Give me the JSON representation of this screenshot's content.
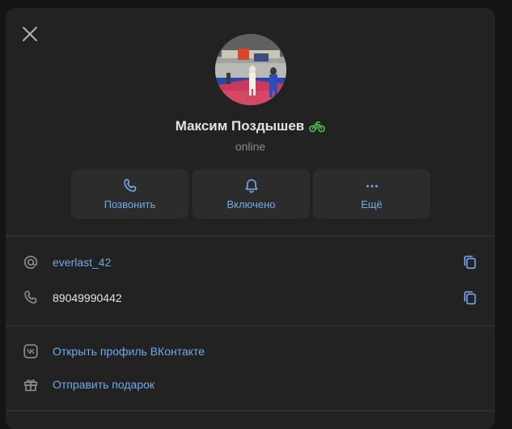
{
  "profile": {
    "name": "Максим Поздышев",
    "status": "online"
  },
  "actions": [
    {
      "label": "Позвонить",
      "icon": "phone-icon"
    },
    {
      "label": "Включено",
      "icon": "bell-icon"
    },
    {
      "label": "Ещё",
      "icon": "more-icon"
    }
  ],
  "contacts": {
    "username": "everlast_42",
    "phone": "89049990442"
  },
  "links": {
    "vk_profile": "Открыть профиль ВКонтакте",
    "send_gift": "Отправить подарок"
  },
  "colors": {
    "background": "#222222",
    "accent": "#71aaeb",
    "text": "#e1e3e6",
    "muted": "#8b8d90",
    "badge_green": "#4bb34b"
  }
}
